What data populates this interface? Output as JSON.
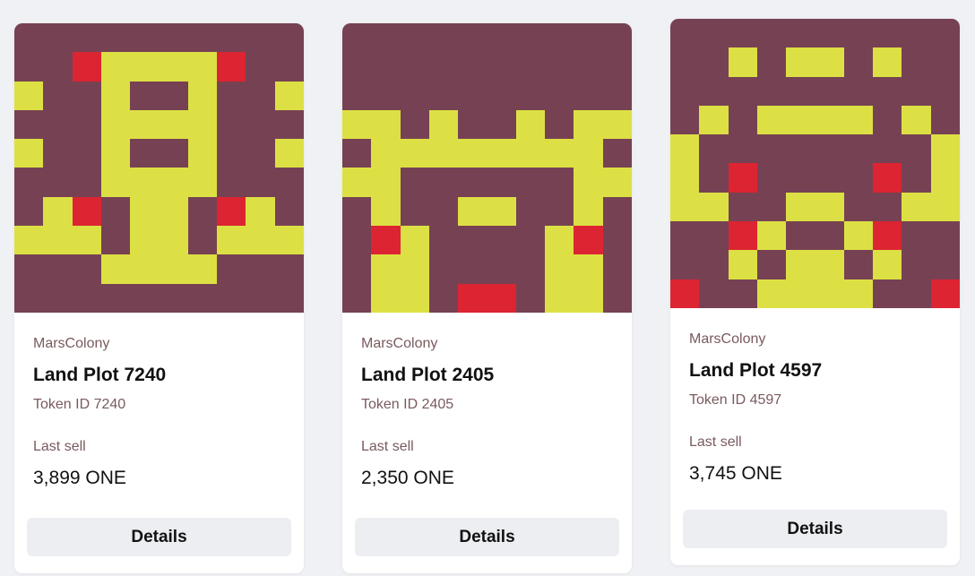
{
  "colors": {
    "M": "#764253",
    "Y": "#dde044",
    "R": "#dd2432",
    "background": "#f0f1f4",
    "card": "#ffffff",
    "button": "#eceef2",
    "muted_text": "#7a5a5e"
  },
  "cards": [
    {
      "collection": "MarsColony",
      "title": "Land Plot 7240",
      "token_id": "Token ID 7240",
      "last_sell_label": "Last sell",
      "price": "3,899 ONE",
      "button_label": "Details",
      "pixels": [
        "MMMMMMMMMM",
        "MMRYYYYRMM",
        "YMMYMMYMMY",
        "MMMYYYYMMM",
        "YMMYMMYMMY",
        "MMMYYYYMMM",
        "MYRMYYMRYM",
        "YYYMYYMYYY",
        "MMMYYYYMMM",
        "MMMMMMMMMM"
      ]
    },
    {
      "collection": "MarsColony",
      "title": "Land Plot 2405",
      "token_id": "Token ID 2405",
      "last_sell_label": "Last sell",
      "price": "2,350 ONE",
      "button_label": "Details",
      "pixels": [
        "MMMMMMMMMM",
        "MMMMMMMMMM",
        "MMMMMMMMMM",
        "YYMYMMYMYY",
        "MYYYYYYYYM",
        "YYMMMMMMYY",
        "MYMMYYMMYM",
        "MRYMMMMYRM",
        "MYYMMMMYYM",
        "MYYMRRMYYM"
      ]
    },
    {
      "collection": "MarsColony",
      "title": "Land Plot 4597",
      "token_id": "Token ID 4597",
      "last_sell_label": "Last sell",
      "price": "3,745 ONE",
      "button_label": "Details",
      "pixels": [
        "MMMMMMMMMM",
        "MMYMYYMYMM",
        "MMMMMMMMMM",
        "MYMYYYYMYM",
        "YMMMMMMMMY",
        "YMRMMMMRMY",
        "YYMMYYMMYY",
        "MMRYMMYRMM",
        "MMYMYYMYMM",
        "RMMYYYYMMR"
      ]
    }
  ]
}
